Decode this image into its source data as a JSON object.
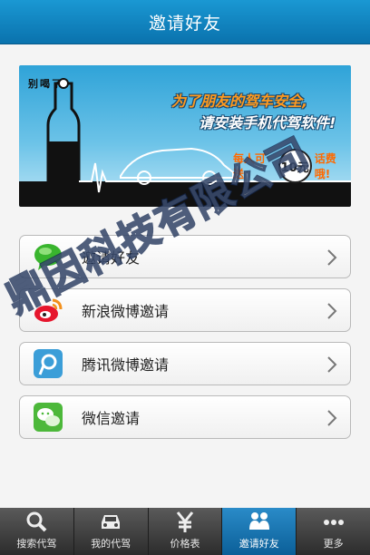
{
  "header": {
    "title": "邀请好友"
  },
  "banner": {
    "small_text": "别喝了",
    "line1": "为了朋友的驾车安全,",
    "line2": "请安装手机代驾软件!",
    "promo_prefix": "每人可送",
    "promo_amount": "10元",
    "promo_suffix": "话费哦!"
  },
  "invite_items": [
    {
      "label": "邀请好友",
      "icon": "chat-bubble-icon"
    },
    {
      "label": "新浪微博邀请",
      "icon": "weibo-icon"
    },
    {
      "label": "腾讯微博邀请",
      "icon": "tencent-weibo-icon"
    },
    {
      "label": "微信邀请",
      "icon": "wechat-icon"
    }
  ],
  "tabs": [
    {
      "label": "搜索代驾",
      "icon": "search-icon"
    },
    {
      "label": "我的代驾",
      "icon": "car-icon"
    },
    {
      "label": "价格表",
      "icon": "yen-icon"
    },
    {
      "label": "邀请好友",
      "icon": "people-icon",
      "active": true
    },
    {
      "label": "更多",
      "icon": "more-icon"
    }
  ],
  "watermark": "鼎因科技有限公司",
  "colors": {
    "header": "#0a72ad",
    "active_tab": "#0b5f98",
    "chat_green": "#39b52e",
    "weibo_red": "#e6162d"
  }
}
